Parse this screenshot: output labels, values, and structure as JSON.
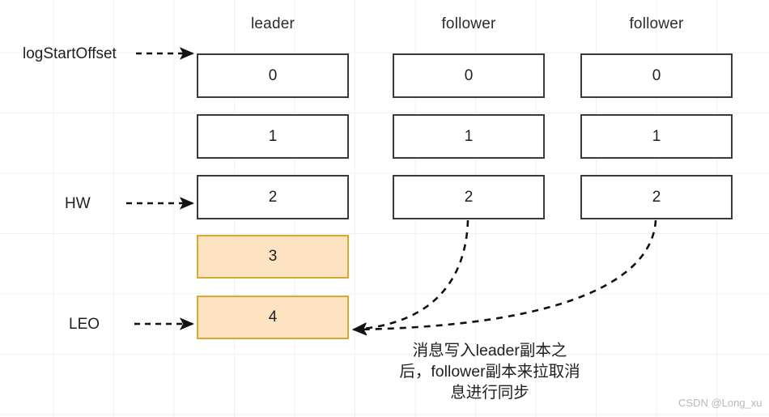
{
  "diagram": {
    "title": "Kafka logStartOffset / HW / LEO replica diagram",
    "columns": [
      {
        "name": "leader-column",
        "label": "leader"
      },
      {
        "name": "follower-column-1",
        "label": "follower"
      },
      {
        "name": "follower-column-2",
        "label": "follower"
      }
    ],
    "row_labels": [
      {
        "name": "logStartOffset",
        "label": "logStartOffset"
      },
      {
        "name": "hw",
        "label": "HW"
      },
      {
        "name": "leo",
        "label": "LEO"
      }
    ],
    "leader_cells": [
      {
        "value": "0",
        "state": "plain"
      },
      {
        "value": "1",
        "state": "plain"
      },
      {
        "value": "2",
        "state": "plain"
      },
      {
        "value": "3",
        "state": "highlight"
      },
      {
        "value": "4",
        "state": "highlight"
      }
    ],
    "follower1_cells": [
      {
        "value": "0",
        "state": "plain"
      },
      {
        "value": "1",
        "state": "plain"
      },
      {
        "value": "2",
        "state": "plain"
      }
    ],
    "follower2_cells": [
      {
        "value": "0",
        "state": "plain"
      },
      {
        "value": "1",
        "state": "plain"
      },
      {
        "value": "2",
        "state": "plain"
      }
    ],
    "annotation": {
      "line1": "消息写入leader副本之",
      "line2": "后，follower副本来拉取消",
      "line3": "息进行同步"
    },
    "watermark": "CSDN @Long_xu",
    "colors": {
      "highlight_fill": "#fde3c2",
      "highlight_border": "#d9a82f",
      "plain_border": "#3a3a3a",
      "grid": "#f1f1f1",
      "text": "#1f1f1f",
      "watermark": "#b8b8b8"
    }
  }
}
